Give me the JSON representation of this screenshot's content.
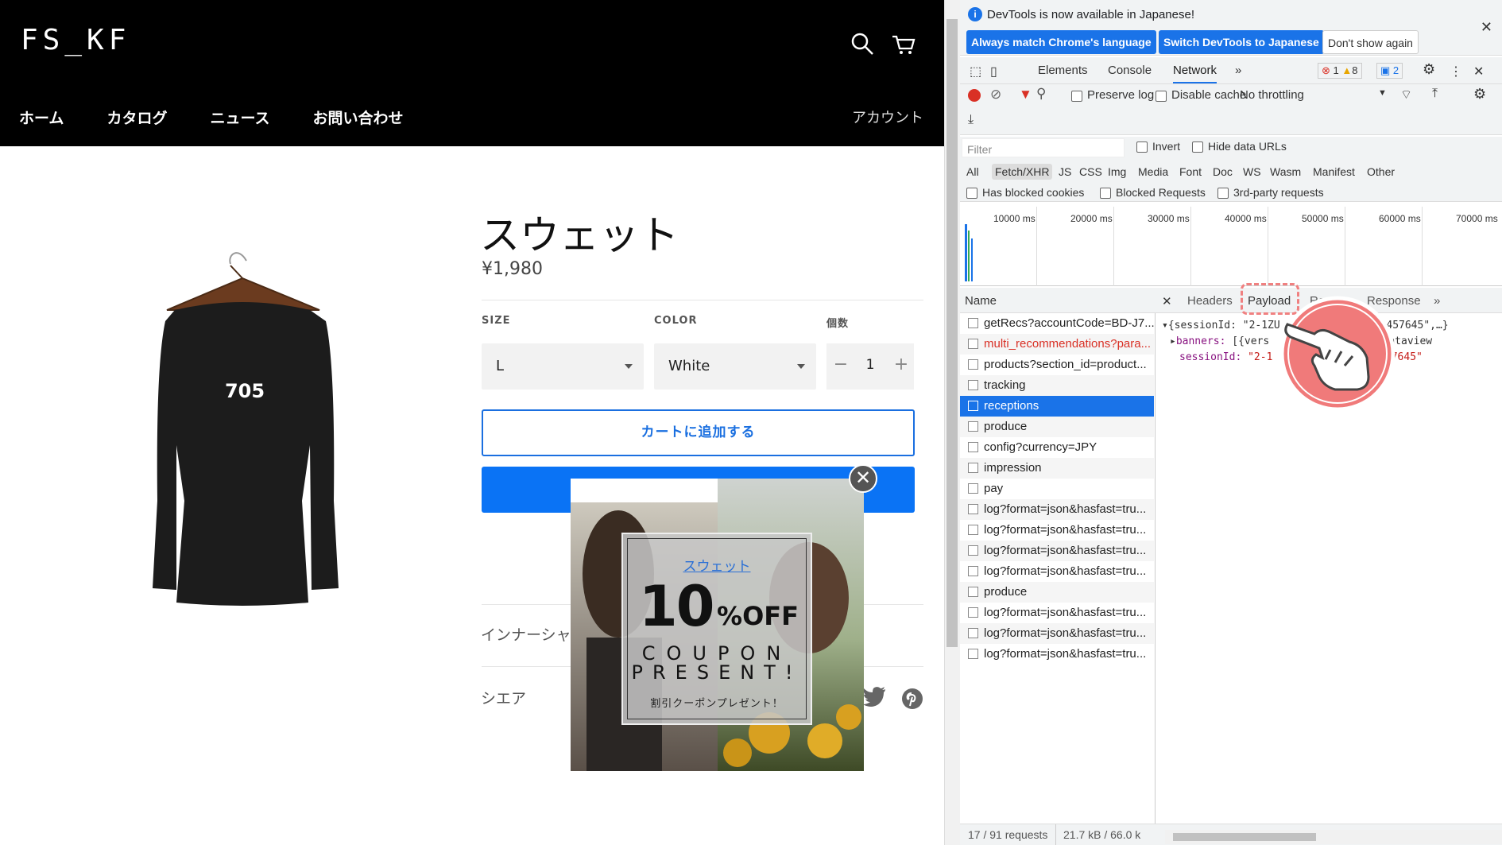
{
  "site": {
    "logo": "FS_KF",
    "nav": [
      "ホーム",
      "カタログ",
      "ニュース",
      "お問い合わせ"
    ],
    "account": "アカウント",
    "product": {
      "title": "スウェット",
      "price": "¥1,980",
      "print": "705",
      "size_label": "SIZE",
      "size_value": "L",
      "color_label": "COLOR",
      "color_value": "White",
      "qty_label": "個数",
      "qty_value": "1",
      "qty_minus": "−",
      "qty_plus": "+",
      "add_to_cart": "カートに追加する",
      "inner_text": "インナーシャ",
      "share_label": "シエア"
    },
    "popup": {
      "close": "✕",
      "link": "スウェット",
      "big_number": "10",
      "off": "%OFF",
      "coupon": "COUPON",
      "present": "PRESENT!",
      "jp": "割引クーポンプレゼント！"
    }
  },
  "devtools": {
    "info": {
      "text": "DevTools is now available in Japanese!",
      "btn_match": "Always match Chrome's language",
      "btn_switch": "Switch DevTools to Japanese",
      "btn_dont": "Don't show again"
    },
    "tabs": [
      "Elements",
      "Console",
      "Network"
    ],
    "active_tab": "Network",
    "errors": "1",
    "warnings": "8",
    "messages": "2",
    "toolbar": {
      "preserve": "Preserve log",
      "disable_cache": "Disable cache",
      "throttle": "No throttling"
    },
    "filter": {
      "placeholder": "Filter",
      "invert": "Invert",
      "hide_data": "Hide data URLs",
      "types": [
        "All",
        "Fetch/XHR",
        "JS",
        "CSS",
        "Img",
        "Media",
        "Font",
        "Doc",
        "WS",
        "Wasm",
        "Manifest",
        "Other"
      ],
      "blocked_cookies": "Has blocked cookies",
      "blocked_req": "Blocked Requests",
      "third_party": "3rd-party requests"
    },
    "timeline_ticks": [
      "10000 ms",
      "20000 ms",
      "30000 ms",
      "40000 ms",
      "50000 ms",
      "60000 ms",
      "70000 ms"
    ],
    "name_header": "Name",
    "requests": [
      "getRecs?accountCode=BD-J7...",
      "multi_recommendations?para...",
      "products?section_id=product...",
      "tracking",
      "receptions",
      "produce",
      "config?currency=JPY",
      "impression",
      "pay",
      "log?format=json&hasfast=tru...",
      "log?format=json&hasfast=tru...",
      "log?format=json&hasfast=tru...",
      "log?format=json&hasfast=tru...",
      "produce",
      "log?format=json&hasfast=tru...",
      "log?format=json&hasfast=tru...",
      "log?format=json&hasfast=tru..."
    ],
    "status": {
      "count": "17 / 91 requests",
      "size": "21.7 kB / 66.0 k"
    },
    "detail": {
      "tabs": [
        "Headers",
        "Payload",
        "Re",
        "Response"
      ],
      "json_line1": "{sessionId: \"2-1ZU",
      "json_line1b": "73457645\",…}",
      "json_banners_key": "banners:",
      "json_banners_val": "[{vers",
      "json_banners_tail": ": 100074, dataview",
      "json_session_key": "sessionId:",
      "json_session_val": "\"2-1",
      "json_session_tail": "73457645\""
    }
  }
}
